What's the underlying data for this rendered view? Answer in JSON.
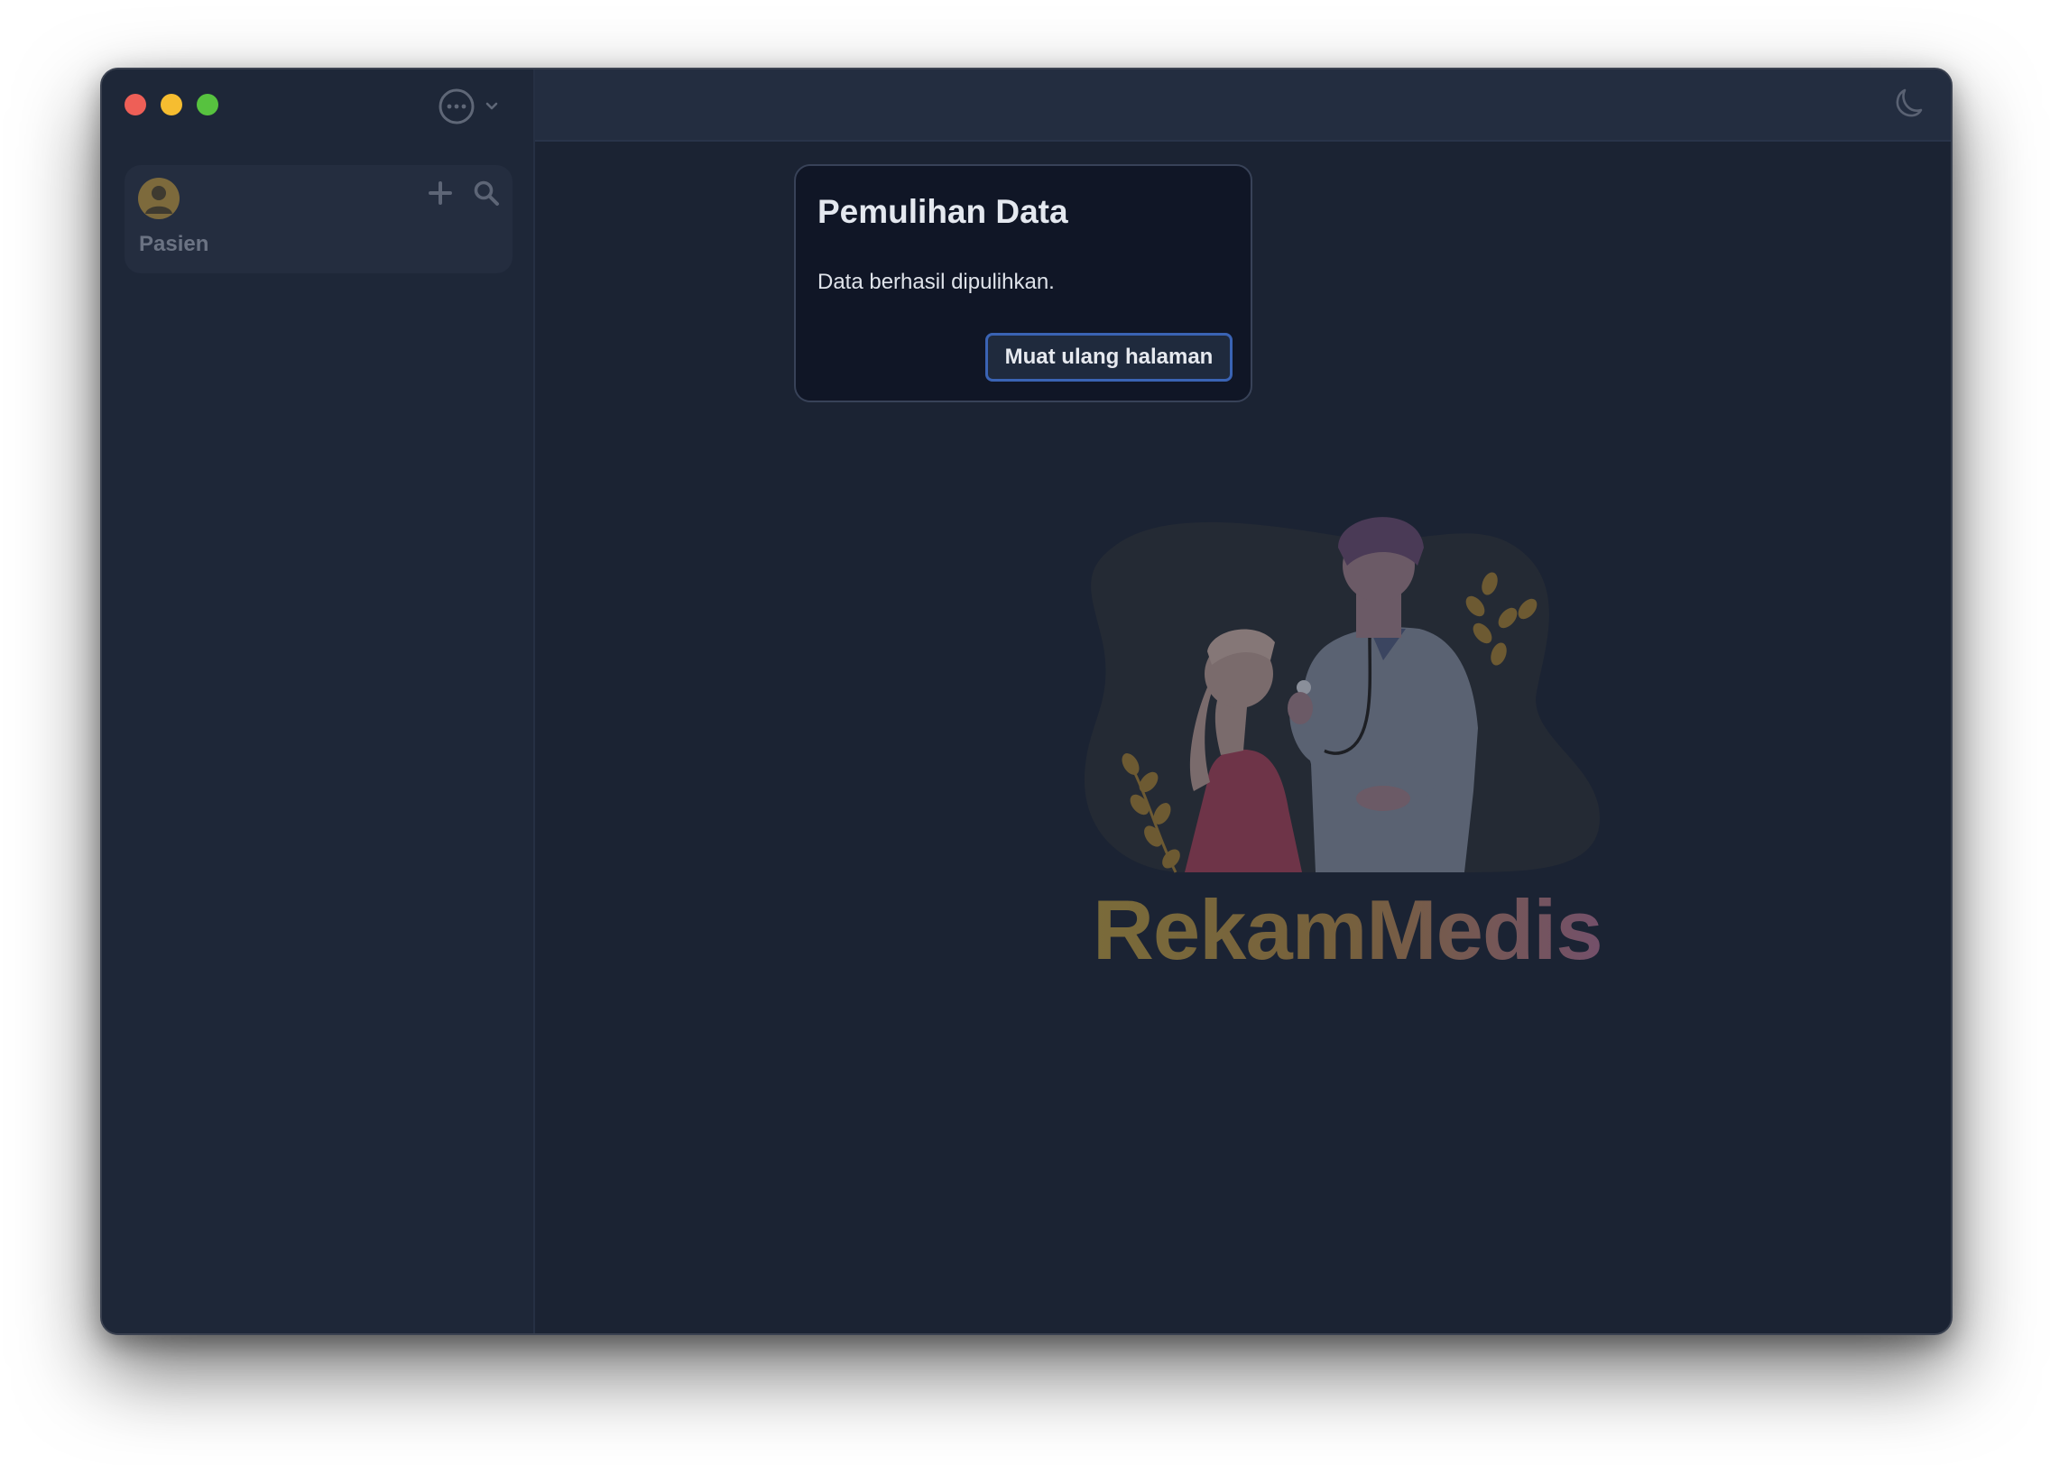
{
  "window": {
    "controls": [
      "close",
      "minimize",
      "maximize"
    ]
  },
  "sidebar": {
    "menu_icon": "more-horizontal-circle-icon",
    "card": {
      "label": "Pasien",
      "avatar_icon": "user-avatar-icon",
      "actions": [
        "plus-icon",
        "search-icon"
      ]
    }
  },
  "topbar": {
    "theme_icon": "moon-icon"
  },
  "dialog": {
    "title": "Pemulihan Data",
    "message": "Data berhasil dipulihkan.",
    "button_label": "Muat ulang halaman"
  },
  "hero": {
    "brand": "RekamMedis"
  },
  "colors": {
    "window_bg": "#1b2333",
    "sidebar_bg": "#1e2738",
    "topbar_bg": "#232d40",
    "dialog_bg": "#101626",
    "button_border": "#3a63b4",
    "traffic_red": "#ee5f57",
    "traffic_yellow": "#f6bd30",
    "traffic_green": "#57c23f"
  }
}
